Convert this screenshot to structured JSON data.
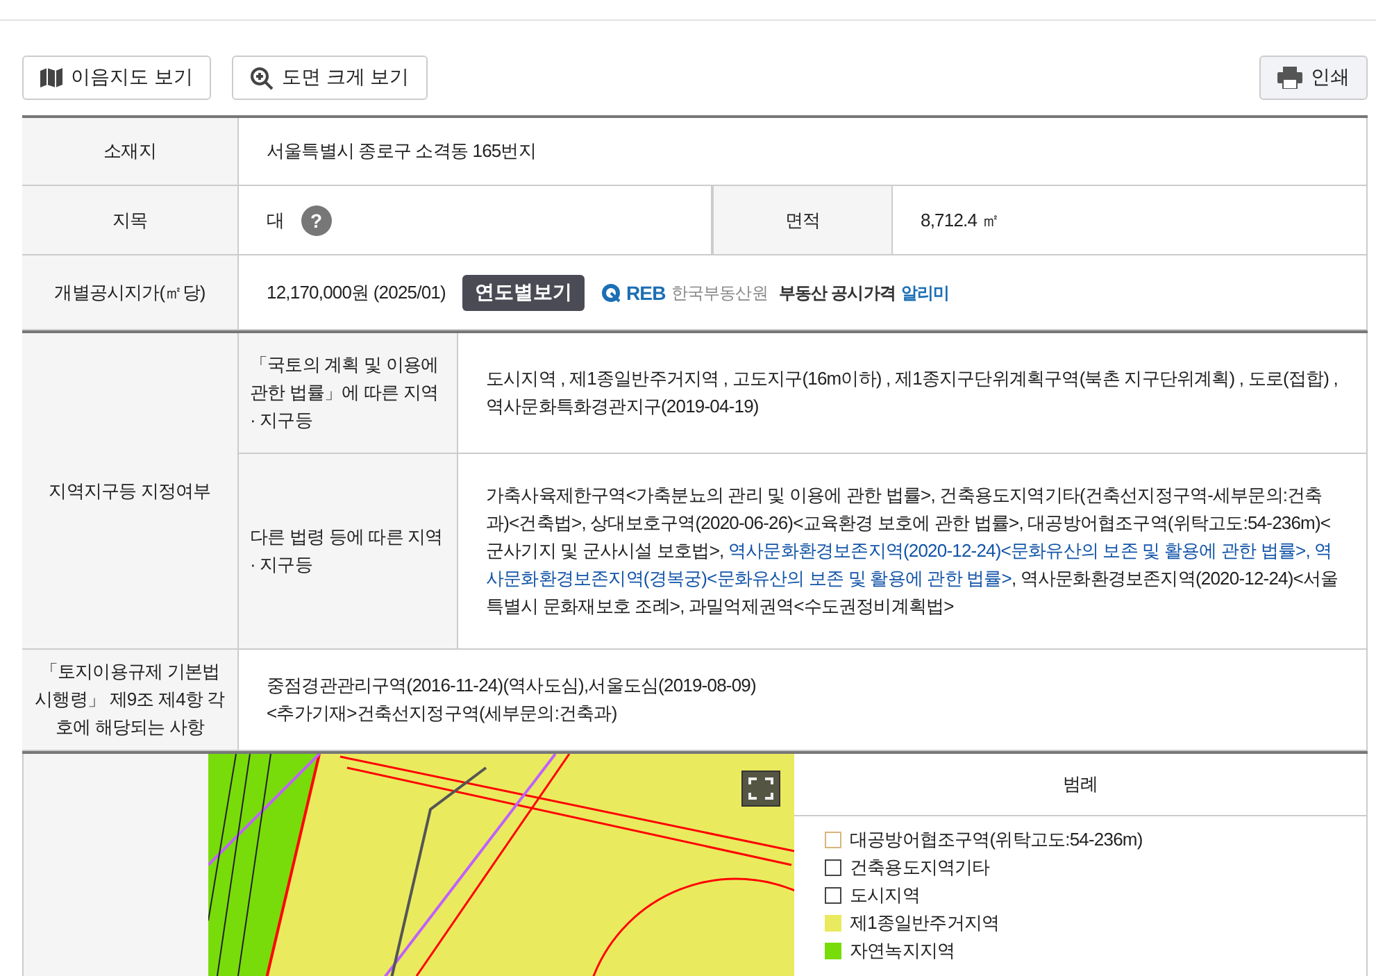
{
  "toolbar": {
    "buttons": [
      {
        "kind": "map",
        "label": "이음지도 보기"
      },
      {
        "kind": "zoom",
        "label": "도면 크게 보기"
      }
    ],
    "print": {
      "label": "인쇄"
    }
  },
  "info": {
    "location": {
      "label": "소재지",
      "value": "서울특별시 종로구 소격동 165번지"
    },
    "land_category": {
      "label": "지목",
      "value": "대",
      "help": "?",
      "area_label": "면적",
      "area_value": "8,712.4 ㎡"
    },
    "price": {
      "label": "개별공시지가(㎡당)",
      "value": "12,170,000원 (2025/01)",
      "button": "연도별보기",
      "logo": {
        "mark": "REB",
        "org": "한국부동산원",
        "service": "부동산 공시가격",
        "highlight": "알리미"
      }
    },
    "zoning": {
      "label": "지역지구등 지정여부",
      "rows": [
        {
          "label": "「국토의 계획 및 이용에 관한 법률」에 따른 지역 · 지구등",
          "segments": [
            {
              "text": "도시지역 , 제1종일반주거지역 , 고도지구(16m이하) , 제1종지구단위계획구역(북촌 지구단위계획) , 도로(접합) , 역사문화특화경관지구(2019-04-19)",
              "link": false
            }
          ]
        },
        {
          "label": "다른 법령 등에 따른 지역 · 지구등",
          "segments": [
            {
              "text": "가축사육제한구역<가축분뇨의 관리 및 이용에 관한 법률>, 건축용도지역기타(건축선지정구역-세부문의:건축과)<건축법>, 상대보호구역(2020-06-26)<교육환경 보호에 관한 법률>, 대공방어협조구역(위탁고도:54-236m)<군사기지 및 군사시설 보호법>, ",
              "link": false
            },
            {
              "text": "역사문화환경보존지역(2020-12-24)<문화유산의 보존 및 활용에 관한 법률>, 역사문화환경보존지역(경복궁)<문화유산의 보존 및 활용에 관한 법률>",
              "link": true
            },
            {
              "text": ", 역사문화환경보존지역(2020-12-24)<서울특별시 문화재보호 조례>, 과밀억제권역<수도권정비계획법>",
              "link": false
            }
          ]
        }
      ]
    },
    "regulation": {
      "label": "「토지이용규제 기본법 시행령」 제9조 제4항 각 호에 해당되는 사항",
      "lines": [
        "중점경관관리구역(2016-11-24)(역사도심),서울도심(2019-08-09)",
        "<추가기재>건축선지정구역(세부문의:건축과)"
      ]
    }
  },
  "legend": {
    "title": "범례",
    "items": [
      {
        "label": "대공방어협조구역(위탁고도:54-236m)",
        "kind": "outline",
        "color": "#d9b47c"
      },
      {
        "label": "건축용도지역기타",
        "kind": "outline",
        "color": "#444444"
      },
      {
        "label": "도시지역",
        "kind": "outline",
        "color": "#444444"
      },
      {
        "label": "제1종일반주거지역",
        "kind": "fill",
        "color": "#eaea5e"
      },
      {
        "label": "자연녹지지역",
        "kind": "fill",
        "color": "#78dc0a"
      }
    ]
  }
}
